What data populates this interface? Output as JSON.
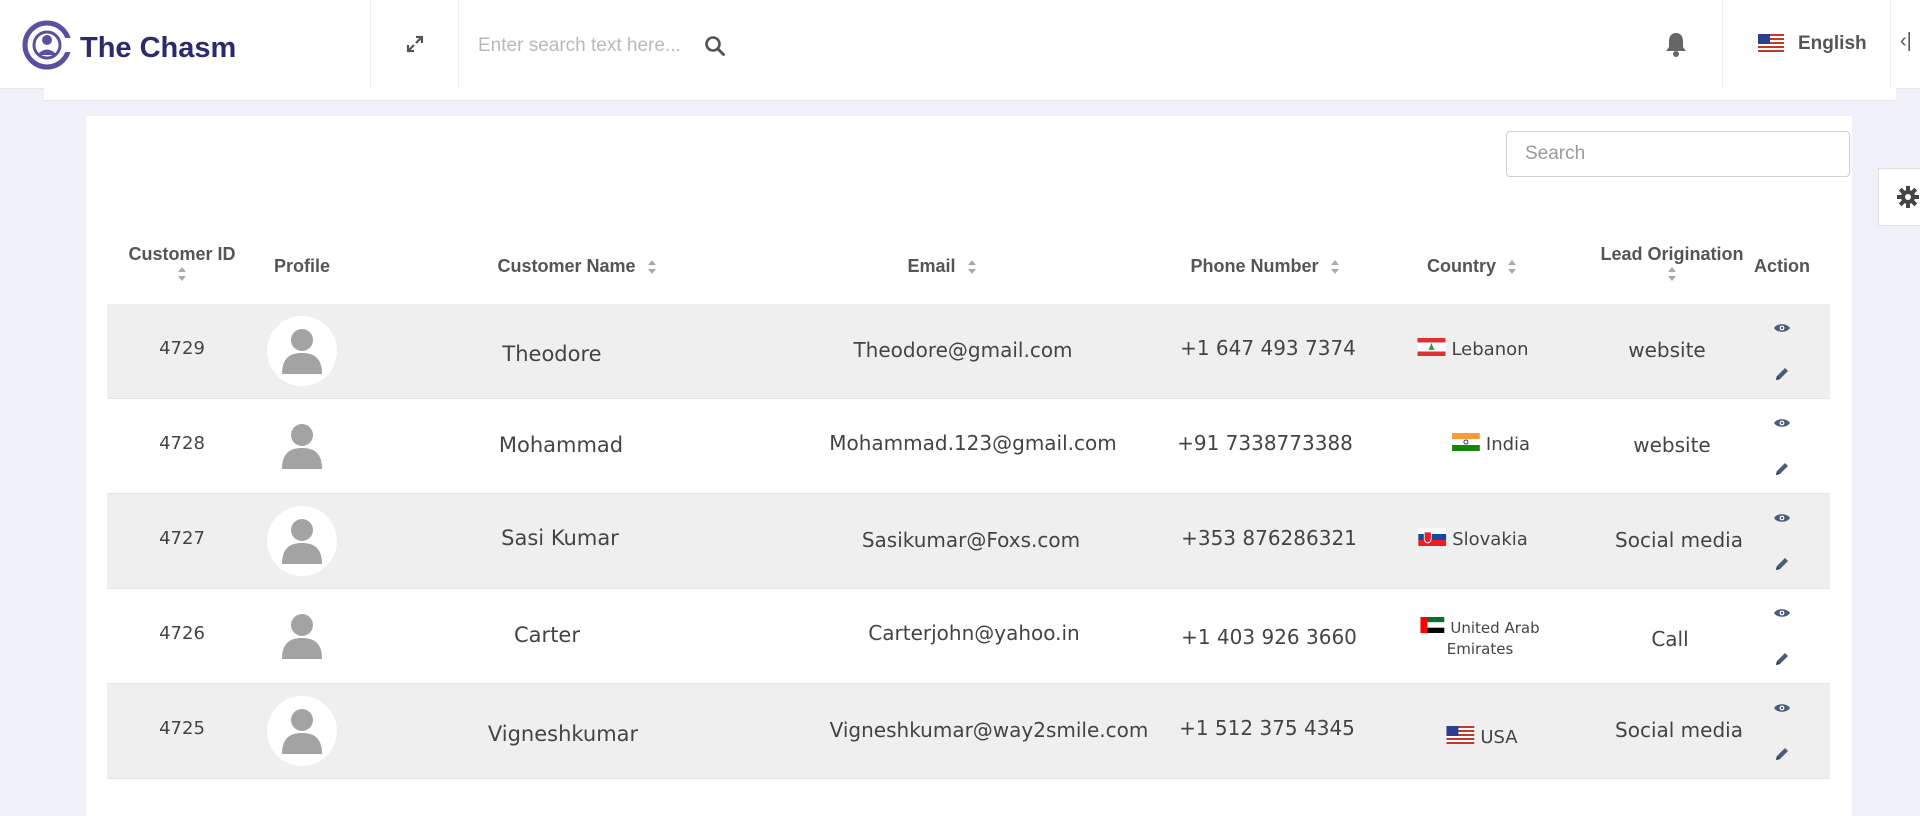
{
  "app": {
    "brand_name": "The Chasm",
    "search_placeholder": "Enter search text here...",
    "language": "English"
  },
  "table": {
    "search_placeholder": "Search",
    "columns": {
      "customer_id": "Customer ID",
      "profile": "Profile",
      "customer_name": "Customer Name",
      "email": "Email",
      "phone": "Phone Number",
      "country": "Country",
      "lead_origination": "Lead Origination",
      "action": "Action"
    },
    "rows": [
      {
        "id": "4729",
        "name": "Theodore",
        "email": "Theodore@gmail.com",
        "phone": "+1 647 493 7374",
        "country": "Lebanon",
        "country_line2": "",
        "flag": "lebanon-flag",
        "lead": "website"
      },
      {
        "id": "4728",
        "name": "Mohammad",
        "email": "Mohammad.123@gmail.com",
        "phone": "+91 7338773388",
        "country": "India",
        "country_line2": "",
        "flag": "india-flag",
        "lead": "website"
      },
      {
        "id": "4727",
        "name": "Sasi Kumar",
        "email": "Sasikumar@Foxs.com",
        "phone": "+353 876286321",
        "country": "Slovakia",
        "country_line2": "",
        "flag": "slovakia-flag",
        "lead": "Social media"
      },
      {
        "id": "4726",
        "name": "Carter",
        "email": "Carterjohn@yahoo.in",
        "phone": "+1 403 926 3660",
        "country": "United Arab",
        "country_line2": "Emirates",
        "flag": "uae-flag",
        "lead": "Call"
      },
      {
        "id": "4725",
        "name": "Vigneshkumar",
        "email": "Vigneshkumar@way2smile.com",
        "phone": "+1 512 375 4345",
        "country": "USA",
        "country_line2": "",
        "flag": "usa-flag",
        "lead": "Social media"
      }
    ]
  },
  "colors": {
    "brand": "#2b2a6e",
    "logo": "#5b4fa0",
    "row_shade": "#efefef",
    "icon_gray": "#a3a3a3",
    "action_icon": "#4a5d78"
  }
}
